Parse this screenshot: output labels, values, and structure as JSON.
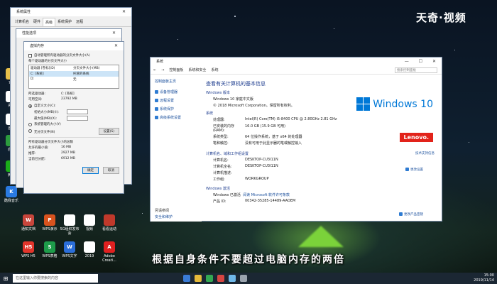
{
  "watermark": "天奇·视频",
  "subtitle": "根据自身条件不要超过电脑内存的两倍",
  "desktop_icons": [
    {
      "label": "通知文档",
      "color": "#c8463c",
      "glyph": "W"
    },
    {
      "label": "WPS演示",
      "color": "#d9531e",
      "glyph": "P"
    },
    {
      "label": "5G组织发布会",
      "color": "#ffffff",
      "glyph": ""
    },
    {
      "label": "视频",
      "color": "#ffffff",
      "glyph": ""
    },
    {
      "label": "看看运动",
      "color": "#c0392b",
      "glyph": ""
    },
    {
      "label": "WPS H5",
      "color": "#e2352b",
      "glyph": "H5"
    },
    {
      "label": "WPS表格",
      "color": "#1e9c4a",
      "glyph": "S"
    },
    {
      "label": "WPS文字",
      "color": "#2b6ed9",
      "glyph": "W"
    },
    {
      "label": "2019",
      "color": "#ffffff",
      "glyph": ""
    },
    {
      "label": "Adobe Creati...",
      "color": "#e02020",
      "glyph": "A"
    }
  ],
  "left_icons": [
    {
      "label": "7月",
      "color": "#e8c14a",
      "glyph": ""
    },
    {
      "label": "头条",
      "color": "#ffffff",
      "glyph": ""
    },
    {
      "label": "迅雷",
      "color": "#ffffff",
      "glyph": ""
    },
    {
      "label": "应用",
      "color": "#2c9c3e",
      "glyph": ""
    },
    {
      "label": "微信",
      "color": "#1aad19",
      "glyph": ""
    },
    {
      "label": "酷我音乐",
      "color": "#2a7ae2",
      "glyph": "K"
    }
  ],
  "sysprop": {
    "title": "系统属性",
    "tabs": [
      "计算机名",
      "硬件",
      "高级",
      "系统保护",
      "远程"
    ]
  },
  "perfopt": {
    "title": "性能选项"
  },
  "vmem": {
    "title": "虚拟内存",
    "auto_manage": "自动管理所有驱动器的分页文件大小(A)",
    "per_drive_label": "每个驱动器的分页文件大小",
    "col_drive": "驱动器 [卷标](D)",
    "col_size": "分页文件大小(MB)",
    "drives": [
      {
        "drive": "C:      [系统]",
        "size": "托管的系统",
        "selected": true
      },
      {
        "drive": "D:",
        "size": "无",
        "selected": false
      }
    ],
    "selected_drive_label": "所选驱动器:",
    "selected_drive_value": "C: [系统]",
    "free_space_label": "可用空间:",
    "free_space_value": "23792 MB",
    "custom_size": "自定义大小(C):",
    "initial_size": "初始大小(MB)(I):",
    "max_size": "最大值(MB)(X):",
    "system_managed": "系统管理的大小(Y)",
    "no_paging": "无分页文件(N)",
    "set_button": "设置(S)",
    "total_label": "所有驱动器分页文件大小的总数",
    "min_allowed_label": "允许的最小值:",
    "min_allowed_value": "16 MB",
    "recommended_label": "推荐:",
    "recommended_value": "2927 MB",
    "current_label": "当前已分配:",
    "current_value": "6912 MB",
    "ok": "确定",
    "cancel": "取消"
  },
  "system_window": {
    "title": "系统",
    "breadcrumbs": [
      "控制面板",
      "系统和安全",
      "系统"
    ],
    "search_placeholder": "搜索控制面板",
    "sidebar": {
      "home": "控制面板主页",
      "links": [
        "设备管理器",
        "远程设置",
        "系统保护",
        "高级系统设置"
      ],
      "see_also": "另请参阅",
      "security": "安全和维护"
    },
    "heading": "查看有关计算机的基本信息",
    "edition_section": "Windows 版本",
    "edition": "Windows 10 家庭中文版",
    "copyright": "© 2018 Microsoft Corporation。保留所有权利。",
    "logo_text": "Windows 10",
    "system_section": "系统",
    "specs": [
      {
        "k": "处理器:",
        "v": "Intel(R) Core(TM) i5-8400 CPU @ 2.80GHz   2.81 GHz"
      },
      {
        "k": "已安装的内存(RAM):",
        "v": "16.0 GB (15.9 GB 可用)"
      },
      {
        "k": "系统类型:",
        "v": "64 位操作系统，基于 x64 的处理器"
      },
      {
        "k": "笔和触控:",
        "v": "没有可用于此显示器的笔或触控输入"
      }
    ],
    "brand": "Lenovo.",
    "tech_support": "技术支持信息",
    "computer_section": "计算机名、域和工作组设置",
    "computer": [
      {
        "k": "计算机名:",
        "v": "DESKTOP-CU3I11N"
      },
      {
        "k": "计算机全名:",
        "v": "DESKTOP-CU3I11N"
      },
      {
        "k": "计算机描述:",
        "v": ""
      },
      {
        "k": "工作组:",
        "v": "WORKGROUP"
      }
    ],
    "change_settings": "更改设置",
    "activation_section": "Windows 激活",
    "activation_status": "Windows 已激活",
    "license_link": "阅读 Microsoft 软件许可条款",
    "product_id_label": "产品 ID:",
    "product_id": "00342-35285-14489-AAOEM",
    "change_key": "更改产品密钥"
  },
  "taskbar": {
    "search_placeholder": "在这里输入你要搜索的内容",
    "time": "15:00",
    "date": "2019/11/14"
  }
}
